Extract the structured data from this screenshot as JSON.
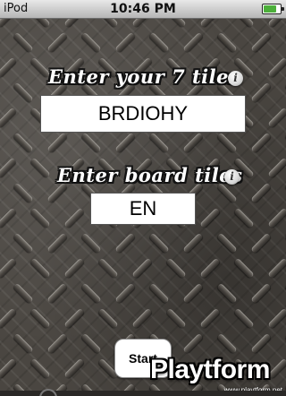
{
  "status_bar": {
    "carrier": "iPod",
    "time": "10:46 PM",
    "battery_level": 0.8,
    "battery_color": "#4caf3a"
  },
  "rack_section": {
    "heading": "Enter your 7 tiles",
    "info_icon": "info-icon",
    "value": "BRDIOHY"
  },
  "board_section": {
    "heading": "Enter board tiles",
    "info_icon": "info-icon",
    "value": "EN"
  },
  "start_button": {
    "label": "Start"
  },
  "watermark": {
    "logo": "Playtform",
    "url": "www.playtform.net"
  }
}
